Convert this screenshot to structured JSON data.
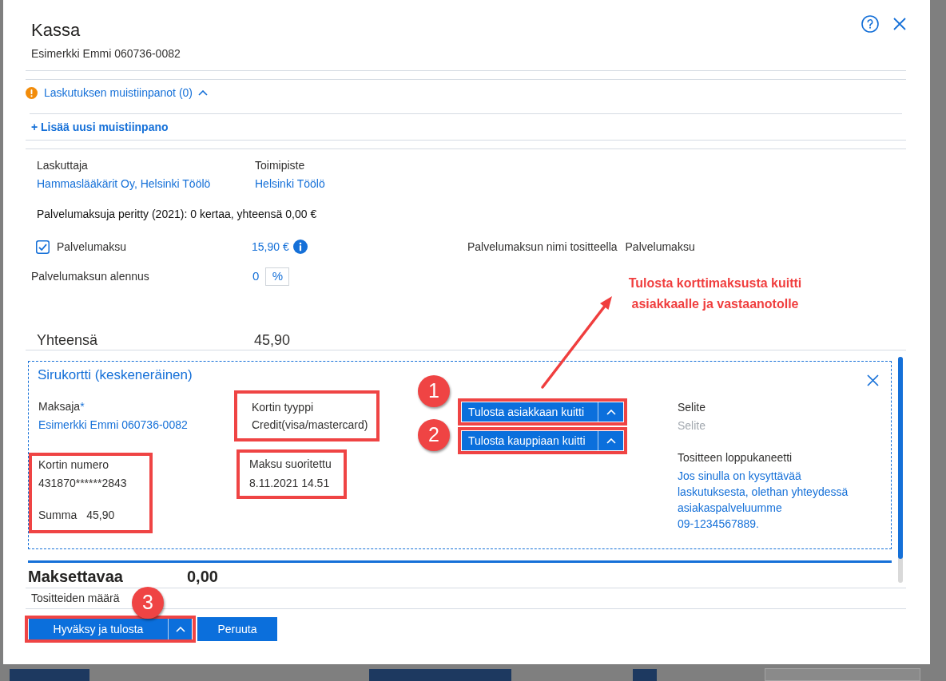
{
  "dialog": {
    "title": "Kassa",
    "subtitle": "Esimerkki Emmi 060736-0082"
  },
  "notes": {
    "label": "Laskutuksen muistiinpanot (0)",
    "expanded": true,
    "add_link": "+ Lisää uusi muistiinpano"
  },
  "billing": {
    "fields": [
      {
        "label": "Laskuttaja",
        "value": "Hammaslääkärit Oy, Helsinki Töölö"
      },
      {
        "label": "Toimipiste",
        "value": "Helsinki Töölö"
      }
    ],
    "fees_collected": "Palvelumaksuja peritty (2021): 0 kertaa, yhteensä 0,00 €"
  },
  "service_fee": {
    "label": "Palvelumaksu",
    "checked": true,
    "amount": "15,90 €",
    "receipt_name_label": "Palvelumaksun nimi tositteella",
    "receipt_name": "Palvelumaksu"
  },
  "discount": {
    "label": "Palvelumaksun alennus",
    "value": "0",
    "unit": "%"
  },
  "total": {
    "label": "Yhteensä",
    "value": "45,90"
  },
  "payment": {
    "title": "Sirukortti (keskeneräinen)",
    "payer": {
      "label": "Maksaja",
      "required_mark": "*",
      "value": "Esimerkki Emmi 060736-0082"
    },
    "card_type": {
      "label": "Kortin tyyppi",
      "value": "Credit(visa/mastercard)",
      "highlighted": true
    },
    "card": {
      "highlighted": true,
      "number_label": "Kortin numero",
      "number": "431870******2843",
      "sum_label": "Summa",
      "sum": "45,90"
    },
    "paid_at": {
      "label": "Maksu suoritettu",
      "value": "8.11.2021 14.51",
      "highlighted": true
    },
    "print_buttons": [
      {
        "label": "Tulosta asiakkaan kuitti",
        "step": "1",
        "highlighted": true
      },
      {
        "label": "Tulosta kauppiaan kuitti",
        "step": "2",
        "highlighted": true
      }
    ],
    "description": {
      "label": "Selite",
      "placeholder": "Selite"
    },
    "closing_note": {
      "label": "Tositteen loppukaneetti",
      "text": "Jos sinulla on kysyttävää laskutuksesta, olethan yhteydessä asiakaspalveluumme 09-1234567889."
    }
  },
  "amount_due": {
    "label": "Maksettavaa",
    "value": "0,00"
  },
  "receipt_count": {
    "label": "Tositteiden määrä"
  },
  "footer_buttons": [
    {
      "label": "Hyväksy ja tulosta",
      "kind": "split",
      "highlighted": true,
      "step": "3"
    },
    {
      "label": "Peruuta",
      "kind": "plain",
      "highlighted": false
    }
  ],
  "annotation": {
    "lines": [
      "Tulosta korttimaksusta kuitti",
      "asiakkaalle ja vastaanotolle"
    ]
  }
}
